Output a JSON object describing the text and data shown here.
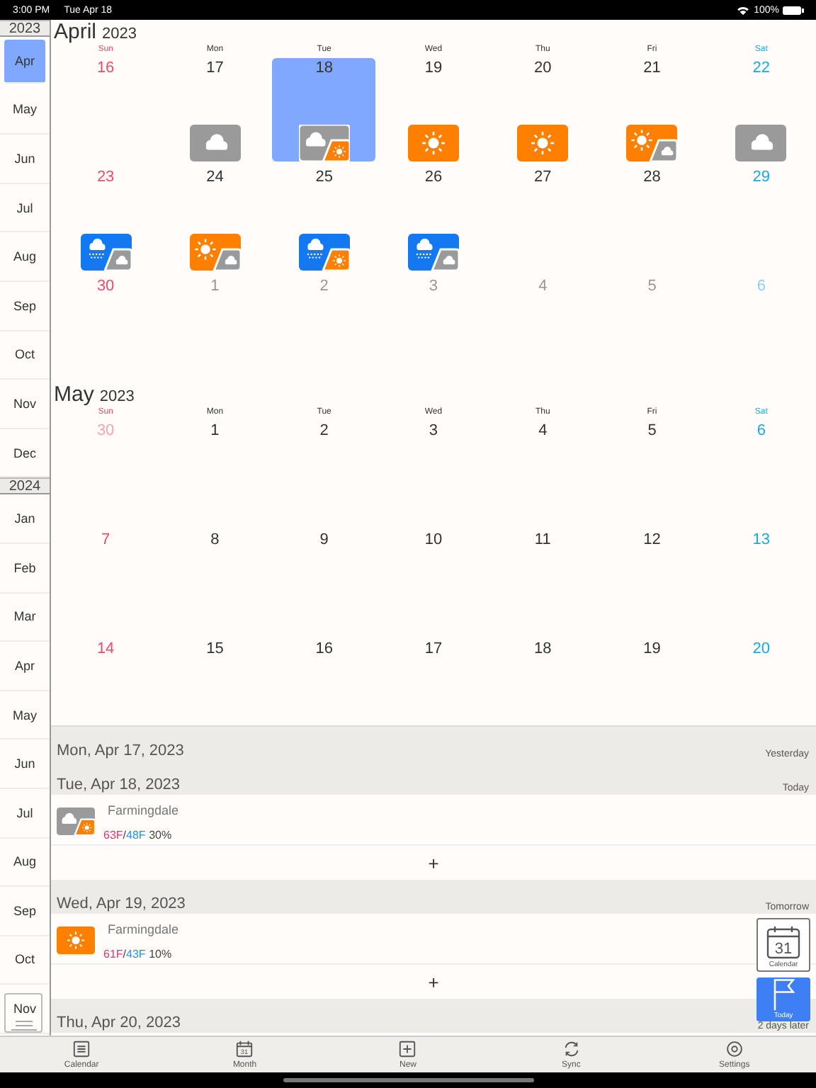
{
  "status_bar": {
    "time": "3:00 PM",
    "date": "Tue Apr 18",
    "battery": "100%"
  },
  "sidebar": [
    {
      "year": "2023",
      "months": [
        {
          "label": "Apr",
          "selected": true
        },
        {
          "label": "May",
          "selected": false
        },
        {
          "label": "Jun",
          "selected": false
        },
        {
          "label": "Jul",
          "selected": false
        },
        {
          "label": "Aug",
          "selected": false
        },
        {
          "label": "Sep",
          "selected": false
        },
        {
          "label": "Oct",
          "selected": false
        },
        {
          "label": "Nov",
          "selected": false
        },
        {
          "label": "Dec",
          "selected": false
        }
      ]
    },
    {
      "year": "2024",
      "months": [
        {
          "label": "Jan",
          "selected": false
        },
        {
          "label": "Feb",
          "selected": false
        },
        {
          "label": "Mar",
          "selected": false
        },
        {
          "label": "Apr",
          "selected": false
        },
        {
          "label": "May",
          "selected": false
        },
        {
          "label": "Jun",
          "selected": false
        },
        {
          "label": "Jul",
          "selected": false
        },
        {
          "label": "Aug",
          "selected": false
        },
        {
          "label": "Sep",
          "selected": false
        },
        {
          "label": "Oct",
          "selected": false
        },
        {
          "label": "Nov",
          "selected": false
        }
      ]
    }
  ],
  "calendar": [
    {
      "month": "April",
      "year": "2023",
      "weekdays": [
        {
          "label": "Sun",
          "kind": "sunday"
        },
        {
          "label": "Mon",
          "kind": "weekday"
        },
        {
          "label": "Tue",
          "kind": "weekday"
        },
        {
          "label": "Wed",
          "kind": "weekday"
        },
        {
          "label": "Thu",
          "kind": "weekday"
        },
        {
          "label": "Fri",
          "kind": "weekday"
        },
        {
          "label": "Sat",
          "kind": "saturday"
        }
      ],
      "weeks": [
        {
          "days": [
            {
              "label": "16",
              "outside": false,
              "selected": false
            },
            {
              "label": "17",
              "outside": false,
              "selected": false,
              "weather": [
                {
                  "kind": "cloud"
                }
              ]
            },
            {
              "label": "18",
              "outside": false,
              "selected": true,
              "weather": [
                {
                  "kind": "cloud"
                },
                {
                  "kind": "sun"
                }
              ]
            },
            {
              "label": "19",
              "outside": false,
              "selected": false,
              "weather": [
                {
                  "kind": "sun"
                }
              ]
            },
            {
              "label": "20",
              "outside": false,
              "selected": false,
              "weather": [
                {
                  "kind": "sun"
                }
              ]
            },
            {
              "label": "21",
              "outside": false,
              "selected": false,
              "weather": [
                {
                  "kind": "sun"
                },
                {
                  "kind": "cloud"
                }
              ]
            },
            {
              "label": "22",
              "outside": false,
              "selected": false,
              "weather": [
                {
                  "kind": "cloud"
                }
              ]
            }
          ]
        },
        {
          "days": [
            {
              "label": "23",
              "outside": false,
              "selected": false,
              "weather": [
                {
                  "kind": "rain"
                },
                {
                  "kind": "cloud"
                }
              ]
            },
            {
              "label": "24",
              "outside": false,
              "selected": false,
              "weather": [
                {
                  "kind": "sun"
                },
                {
                  "kind": "cloud"
                }
              ]
            },
            {
              "label": "25",
              "outside": false,
              "selected": false,
              "weather": [
                {
                  "kind": "rain"
                },
                {
                  "kind": "sun"
                }
              ]
            },
            {
              "label": "26",
              "outside": false,
              "selected": false,
              "weather": [
                {
                  "kind": "rain"
                },
                {
                  "kind": "cloud"
                }
              ]
            },
            {
              "label": "27",
              "outside": false,
              "selected": false
            },
            {
              "label": "28",
              "outside": false,
              "selected": false
            },
            {
              "label": "29",
              "outside": false,
              "selected": false
            }
          ]
        },
        {
          "days": [
            {
              "label": "30",
              "outside": false,
              "selected": false
            },
            {
              "label": "1",
              "outside": true,
              "selected": false
            },
            {
              "label": "2",
              "outside": true,
              "selected": false
            },
            {
              "label": "3",
              "outside": true,
              "selected": false
            },
            {
              "label": "4",
              "outside": true,
              "selected": false
            },
            {
              "label": "5",
              "outside": true,
              "selected": false
            },
            {
              "label": "6",
              "outside": true,
              "selected": false
            }
          ]
        }
      ]
    },
    {
      "month": "May",
      "year": "2023",
      "weekdays": [
        {
          "label": "Sun",
          "kind": "sunday"
        },
        {
          "label": "Mon",
          "kind": "weekday"
        },
        {
          "label": "Tue",
          "kind": "weekday"
        },
        {
          "label": "Wed",
          "kind": "weekday"
        },
        {
          "label": "Thu",
          "kind": "weekday"
        },
        {
          "label": "Fri",
          "kind": "weekday"
        },
        {
          "label": "Sat",
          "kind": "saturday"
        }
      ],
      "weeks": [
        {
          "days": [
            {
              "label": "30",
              "outside": true,
              "selected": false
            },
            {
              "label": "1",
              "outside": false,
              "selected": false
            },
            {
              "label": "2",
              "outside": false,
              "selected": false
            },
            {
              "label": "3",
              "outside": false,
              "selected": false
            },
            {
              "label": "4",
              "outside": false,
              "selected": false
            },
            {
              "label": "5",
              "outside": false,
              "selected": false
            },
            {
              "label": "6",
              "outside": false,
              "selected": false
            }
          ]
        },
        {
          "days": [
            {
              "label": "7",
              "outside": false,
              "selected": false
            },
            {
              "label": "8",
              "outside": false,
              "selected": false
            },
            {
              "label": "9",
              "outside": false,
              "selected": false
            },
            {
              "label": "10",
              "outside": false,
              "selected": false
            },
            {
              "label": "11",
              "outside": false,
              "selected": false
            },
            {
              "label": "12",
              "outside": false,
              "selected": false
            },
            {
              "label": "13",
              "outside": false,
              "selected": false
            }
          ]
        },
        {
          "days": [
            {
              "label": "14",
              "outside": false,
              "selected": false
            },
            {
              "label": "15",
              "outside": false,
              "selected": false
            },
            {
              "label": "16",
              "outside": false,
              "selected": false
            },
            {
              "label": "17",
              "outside": false,
              "selected": false
            },
            {
              "label": "18",
              "outside": false,
              "selected": false
            },
            {
              "label": "19",
              "outside": false,
              "selected": false
            },
            {
              "label": "20",
              "outside": false,
              "selected": false
            }
          ]
        }
      ]
    }
  ],
  "agenda": [
    {
      "date": "Mon, Apr 17, 2023",
      "relative": "Yesterday"
    },
    {
      "date": "Tue, Apr 18, 2023",
      "relative": "Today",
      "entry": {
        "place": "Farmingdale",
        "weather": [
          {
            "kind": "cloud"
          },
          {
            "kind": "sun"
          }
        ],
        "high": "63F",
        "separator": "/",
        "low": "48F",
        "precip": "30%"
      },
      "add": "+"
    },
    {
      "date": "Wed, Apr 19, 2023",
      "relative": "Tomorrow",
      "entry": {
        "place": "Farmingdale",
        "weather": [
          {
            "kind": "sun"
          }
        ],
        "high": "61F",
        "separator": "/",
        "low": "43F",
        "precip": "10%"
      },
      "add": "+"
    },
    {
      "date": "Thu, Apr 20, 2023",
      "relative": "2 days later"
    }
  ],
  "calendar_button": {
    "label": "Calendar",
    "icon_text": "31"
  },
  "today_button": {
    "label": "Today"
  },
  "tab_bar": [
    {
      "label": "Calendar",
      "kind": "list"
    },
    {
      "label": "Month",
      "kind": "month",
      "icon_text": "31"
    },
    {
      "label": "New",
      "kind": "new"
    },
    {
      "label": "Sync",
      "kind": "sync"
    },
    {
      "label": "Settings",
      "kind": "settings"
    }
  ]
}
